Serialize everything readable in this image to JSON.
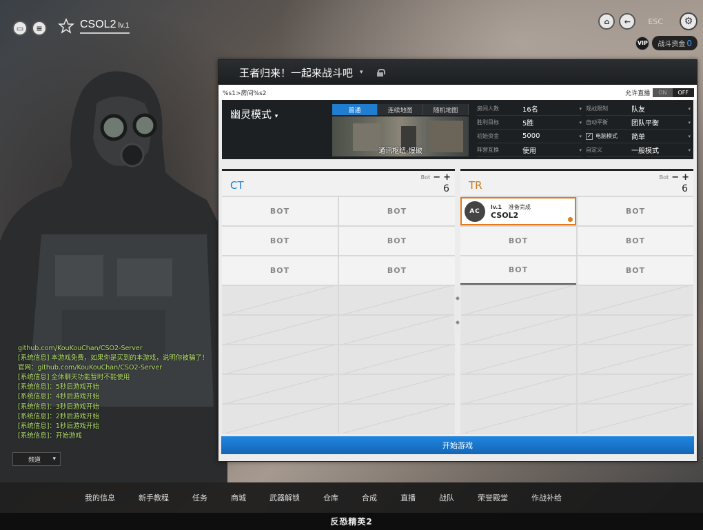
{
  "header": {
    "player_name": "CSOL2",
    "player_level": "lv.1",
    "esc_label": "ESC",
    "fund_label": "战斗资金",
    "fund_value": "0",
    "vip_label": "VIP"
  },
  "room": {
    "title": "王者归来！一起来战斗吧",
    "path": "%s1>房间%s2",
    "live_label": "允许直播",
    "toggle_on": "ON",
    "toggle_off": "OFF",
    "mode": "幽灵模式",
    "map_tabs": [
      "普通",
      "连续地图",
      "随机地图"
    ],
    "map_name": "通讯枢纽-爆破",
    "options": [
      {
        "label": "房间人数",
        "value": "16名"
      },
      {
        "label": "观战限制",
        "value": "队友"
      },
      {
        "label": "胜利目标",
        "value": "5胜"
      },
      {
        "label": "自动平衡",
        "value": "团队平衡"
      },
      {
        "label": "初始资金",
        "value": "5000"
      },
      {
        "label": "电脑模式",
        "value": "简单"
      },
      {
        "label": "阵营互换",
        "value": "使用"
      },
      {
        "label": "自定义",
        "value": "一般模式"
      }
    ],
    "start_label": "开始游戏"
  },
  "teams": {
    "ct": {
      "name": "CT",
      "bot_label": "Bot",
      "count": "6"
    },
    "tr": {
      "name": "TR",
      "bot_label": "Bot",
      "count": "6"
    },
    "bot_slot_label": "BOT",
    "player": {
      "level": "lv.1",
      "status": "准备完成",
      "name": "CSOL2"
    }
  },
  "chat": {
    "lines": [
      "github.com/KouKouChan/CSO2-Server",
      "[系统信息] 本游戏免费，如果你是买到的本游戏，说明你被骗了！",
      "官网：github.com/KouKouChan/CSO2-Server",
      "[系统信息] 全体聊天功能暂时不能使用",
      "[系统信息]：5秒后游戏开始",
      "[系统信息]：4秒后游戏开始",
      "[系统信息]：3秒后游戏开始",
      "[系统信息]：2秒后游戏开始",
      "[系统信息]：1秒后游戏开始",
      "[系统信息]：开始游戏"
    ],
    "channel": "频道"
  },
  "nav": [
    "我的信息",
    "新手教程",
    "任务",
    "商城",
    "武器解锁",
    "仓库",
    "合成",
    "直播",
    "战队",
    "荣誉殿堂",
    "作战补给"
  ],
  "footer": {
    "logo": "反恐精英2"
  }
}
